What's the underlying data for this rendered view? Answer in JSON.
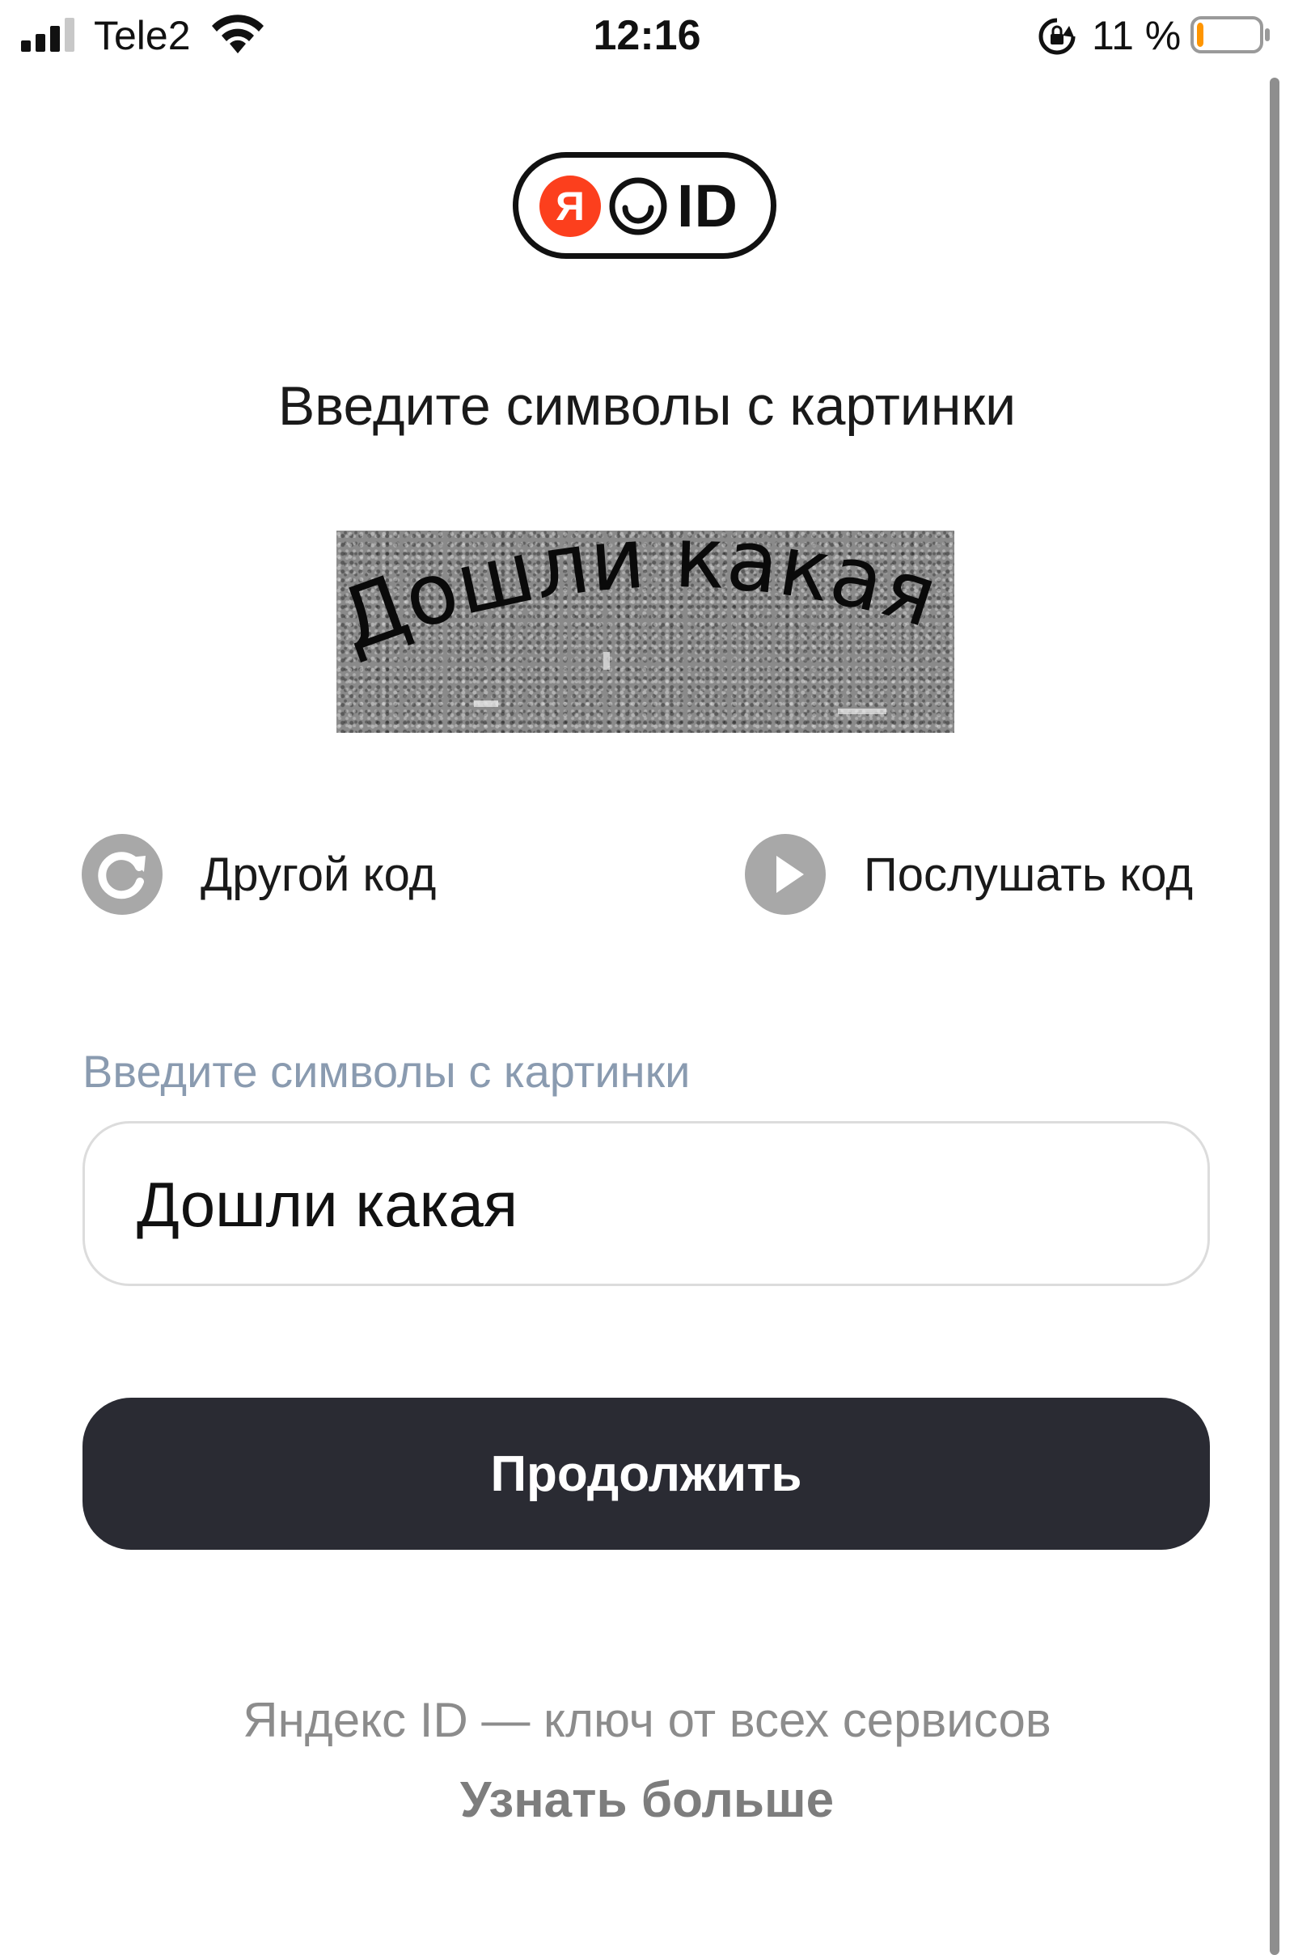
{
  "status_bar": {
    "carrier": "Tele2",
    "time": "12:16",
    "battery_percent": "11 %",
    "battery_level": 0.11,
    "battery_color": "#ff9500"
  },
  "logo": {
    "ya_letter": "Я",
    "id_text": "ID",
    "ya_color": "#fc3f1d",
    "icon": "yandex-id-logo"
  },
  "captcha": {
    "heading": "Введите символы с картинки",
    "image_text": "Дошли какая",
    "reload_label": "Другой код",
    "reload_icon": "refresh-icon",
    "listen_label": "Послушать код",
    "listen_icon": "play-icon"
  },
  "form": {
    "field_label": "Введите символы с картинки",
    "input_value": "Дошли какая",
    "submit_label": "Продолжить",
    "button_color": "#2a2b33"
  },
  "footer": {
    "tagline": "Яндекс ID — ключ от всех сервисов",
    "learn_more": "Узнать больше"
  }
}
